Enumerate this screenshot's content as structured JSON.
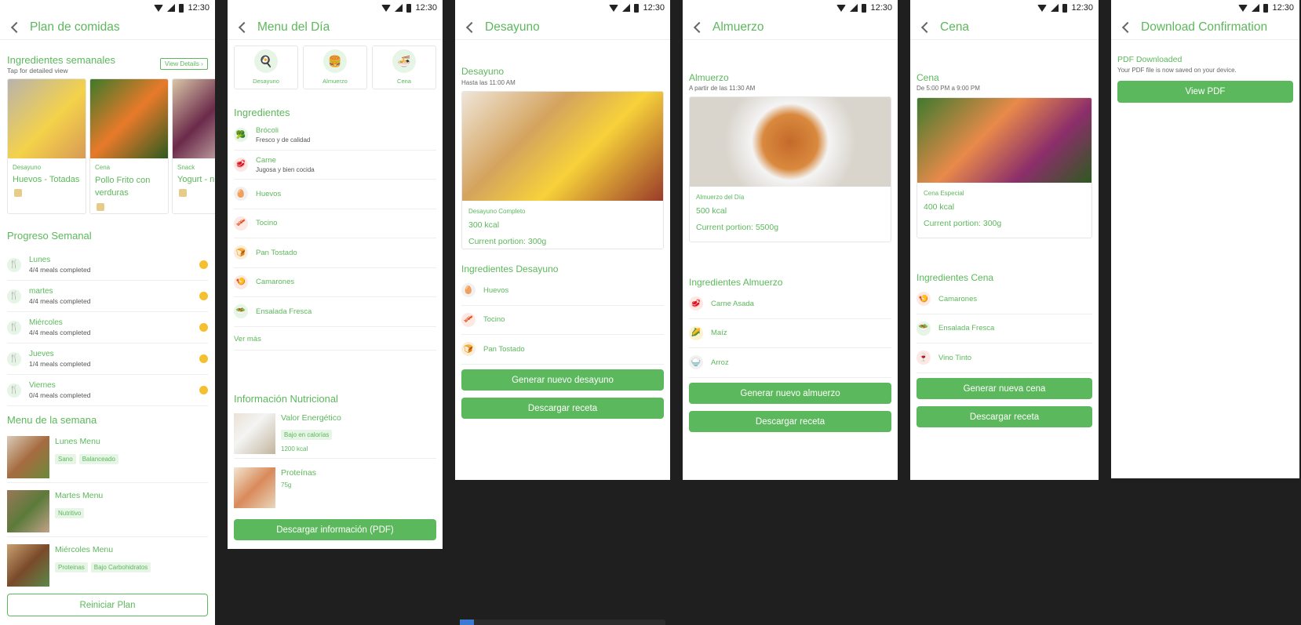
{
  "status_time": "12:30",
  "s1": {
    "title": "Plan de comidas",
    "weekly_title": "Ingredientes semanales",
    "weekly_sub": "Tap for detailed view",
    "view_details": "View Details",
    "cards": [
      {
        "cat": "Desayuno",
        "name": "Huevos - Totadas"
      },
      {
        "cat": "Cena",
        "name": "Pollo Frito con verduras"
      },
      {
        "cat": "Snack",
        "name": "Yogurt - nu"
      }
    ],
    "progress_title": "Progreso Semanal",
    "progress": [
      {
        "day": "Lunes",
        "meals": "4/4 meals completed"
      },
      {
        "day": "martes",
        "meals": "4/4 meals completed"
      },
      {
        "day": "Miércoles",
        "meals": "4/4 meals completed"
      },
      {
        "day": "Jueves",
        "meals": "1/4 meals completed"
      },
      {
        "day": "Viernes",
        "meals": "0/4 meals completed"
      }
    ],
    "menu_title": "Menu de la semana",
    "menus": [
      {
        "name": "Lunes Menu",
        "tags": [
          "Sano",
          "Balanceado"
        ]
      },
      {
        "name": "Martes Menu",
        "tags": [
          "Nutritivo"
        ]
      },
      {
        "name": "Miércoles Menu",
        "tags": [
          "Proteinas",
          "Bajo Carbohidratos"
        ]
      }
    ],
    "reset": "Reiniciar Plan"
  },
  "s2": {
    "title": "Menu del Día",
    "tabs": [
      "Desayuno",
      "Almuerzo",
      "Cena"
    ],
    "ing_title": "Ingredientes",
    "ingredients": [
      {
        "name": "Brócoli",
        "sub": "Fresco y de calidad"
      },
      {
        "name": "Carne",
        "sub": "Jugosa y bien cocida"
      },
      {
        "name": "Huevos",
        "sub": ""
      },
      {
        "name": "Tocino",
        "sub": ""
      },
      {
        "name": "Pan Tostado",
        "sub": ""
      },
      {
        "name": "Camarones",
        "sub": ""
      },
      {
        "name": "Ensalada Fresca",
        "sub": ""
      }
    ],
    "more": "Ver más",
    "nutri_title": "Información Nutricional",
    "nutri": [
      {
        "name": "Valor Energético",
        "tag": "Bajo en calorías",
        "val": "1200 kcal"
      },
      {
        "name": "Proteínas",
        "tag": "",
        "val": "75g"
      }
    ],
    "pdf_btn": "Descargar información (PDF)"
  },
  "s3": {
    "title": "Desayuno",
    "meal": "Desayuno",
    "time": "Hasta las 11:00 AM",
    "card_cat": "Desayuno Completo",
    "kcal": "300 kcal",
    "portion": "Current portion: 300g",
    "ing_title": "Ingredientes Desayuno",
    "ingredients": [
      "Huevos",
      "Tocino",
      "Pan Tostado"
    ],
    "btn1": "Generar nuevo desayuno",
    "btn2": "Descargar receta"
  },
  "s4": {
    "title": "Almuerzo",
    "meal": "Almuerzo",
    "time": "A partir de las 11:30 AM",
    "card_cat": "Almuerzo del Día",
    "kcal": "500 kcal",
    "portion": "Current portion: 5500g",
    "ing_title": "Ingredientes Almuerzo",
    "ingredients": [
      "Carne Asada",
      "Maíz",
      "Arroz"
    ],
    "btn1": "Generar nuevo almuerzo",
    "btn2": "Descargar receta"
  },
  "s5": {
    "title": "Cena",
    "meal": "Cena",
    "time": "De 5:00 PM a 9:00 PM",
    "card_cat": "Cena Especial",
    "kcal": "400 kcal",
    "portion": "Current portion: 300g",
    "ing_title": "Ingredientes Cena",
    "ingredients": [
      "Camarones",
      "Ensalada Fresca",
      "Vino Tinto"
    ],
    "btn1": "Generar nueva cena",
    "btn2": "Descargar receta"
  },
  "s6": {
    "title": "Download Confirmation",
    "heading": "PDF Downloaded",
    "sub": "Your PDF file is now saved on your device.",
    "btn": "View PDF"
  }
}
